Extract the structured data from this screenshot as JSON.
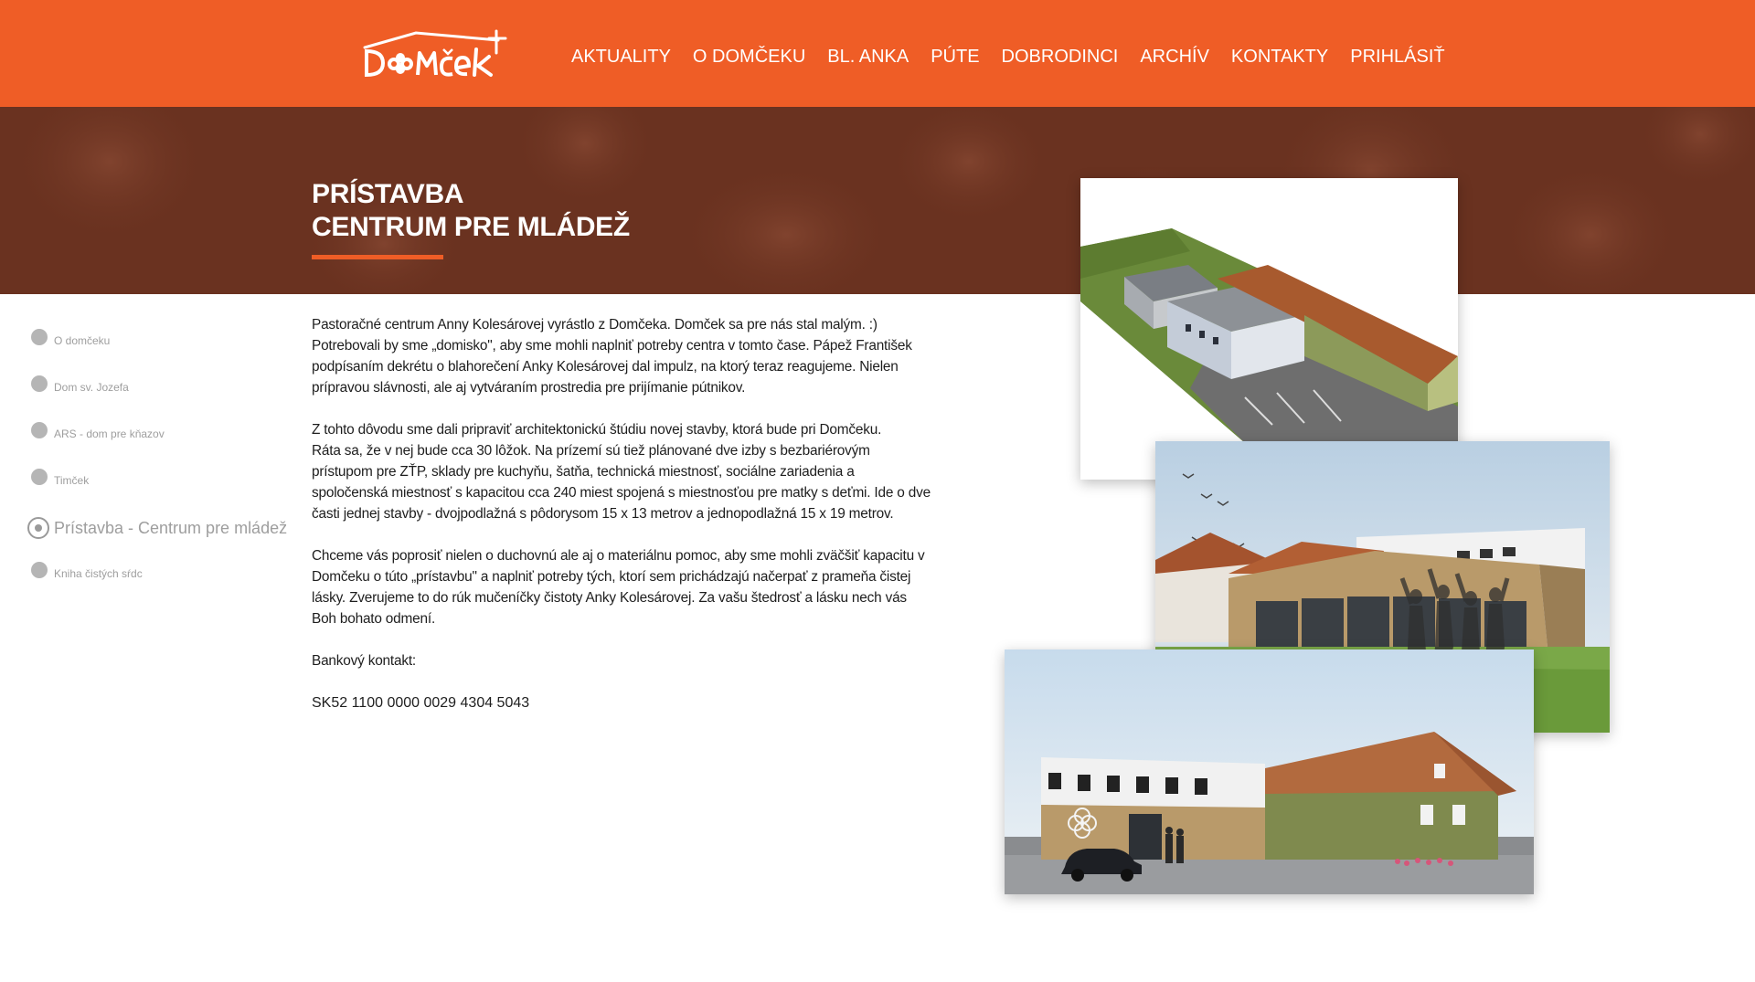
{
  "header": {
    "logo_text": "DOMČEK",
    "brand_color": "#ef5d26",
    "nav": [
      {
        "label": "AKTUALITY"
      },
      {
        "label": "O DOMČEKU"
      },
      {
        "label": "BL. ANKA"
      },
      {
        "label": "PÚTE"
      },
      {
        "label": "DOBRODINCI"
      },
      {
        "label": "ARCHÍV"
      },
      {
        "label": "KONTAKTY"
      },
      {
        "label": "PRIHLÁSIŤ"
      }
    ]
  },
  "hero": {
    "title_line1": "PRÍSTAVBA",
    "title_line2": "CENTRUM PRE MLÁDEŽ"
  },
  "sidenav": {
    "items": [
      {
        "label": "O domčeku",
        "active": false
      },
      {
        "label": "Dom sv. Jozefa",
        "active": false
      },
      {
        "label": "ARS - dom pre kňazov",
        "active": false
      },
      {
        "label": "Timček",
        "active": false
      },
      {
        "label": "Prístavba - Centrum pre mládež",
        "active": true
      },
      {
        "label": "Kniha čistých sŕdc",
        "active": false
      }
    ]
  },
  "content": {
    "p1": "Pastoračné centrum Anny Kolesárovej vyrástlo z Domčeka. Domček sa pre nás stal malým. :) Potrebovali by sme „domisko\", aby sme mohli naplniť potreby centra v tomto čase. Pápež František podpísaním dekrétu o blahorečení Anky Kolesárovej dal impulz, na ktorý teraz reagujeme. Nielen prípravou slávnosti, ale aj vytváraním prostredia pre prijímanie pútnikov.",
    "p2a": "Z tohto dôvodu sme dali pripraviť architektonickú štúdiu novej stavby, ktorá bude pri Domčeku.",
    "p2b": "Ráta sa, že v nej bude cca 30 lôžok. Na prízemí sú tiež plánované dve izby s bezbariérovým prístupom pre ZŤP, sklady pre kuchyňu, šatňa, technická miestnosť, sociálne zariadenia a spoločenská miestnosť s kapacitou cca 240 miest spojená s miestnosťou pre matky s deťmi. Ide o dve časti jednej stavby - dvojpodlažná s pôdorysom 15 x 13 metrov a jednopodlažná 15 x 19 metrov.",
    "p3": "Chceme vás poprosiť nielen o duchovnú ale aj o materiálnu pomoc, aby sme mohli zväčšiť kapacitu v Domčeku o túto „prístavbu\" a naplniť potreby tých, ktorí sem prichádzajú načerpať z prameňa čistej lásky. Zverujeme to do rúk mučeníčky čistoty Anky Kolesárovej. Za vašu štedrosť a lásku nech vás Boh bohato odmení.",
    "bank_label": "Bankový kontakt:",
    "iban": "SK52 1100 0000 0029 4304 5043"
  }
}
